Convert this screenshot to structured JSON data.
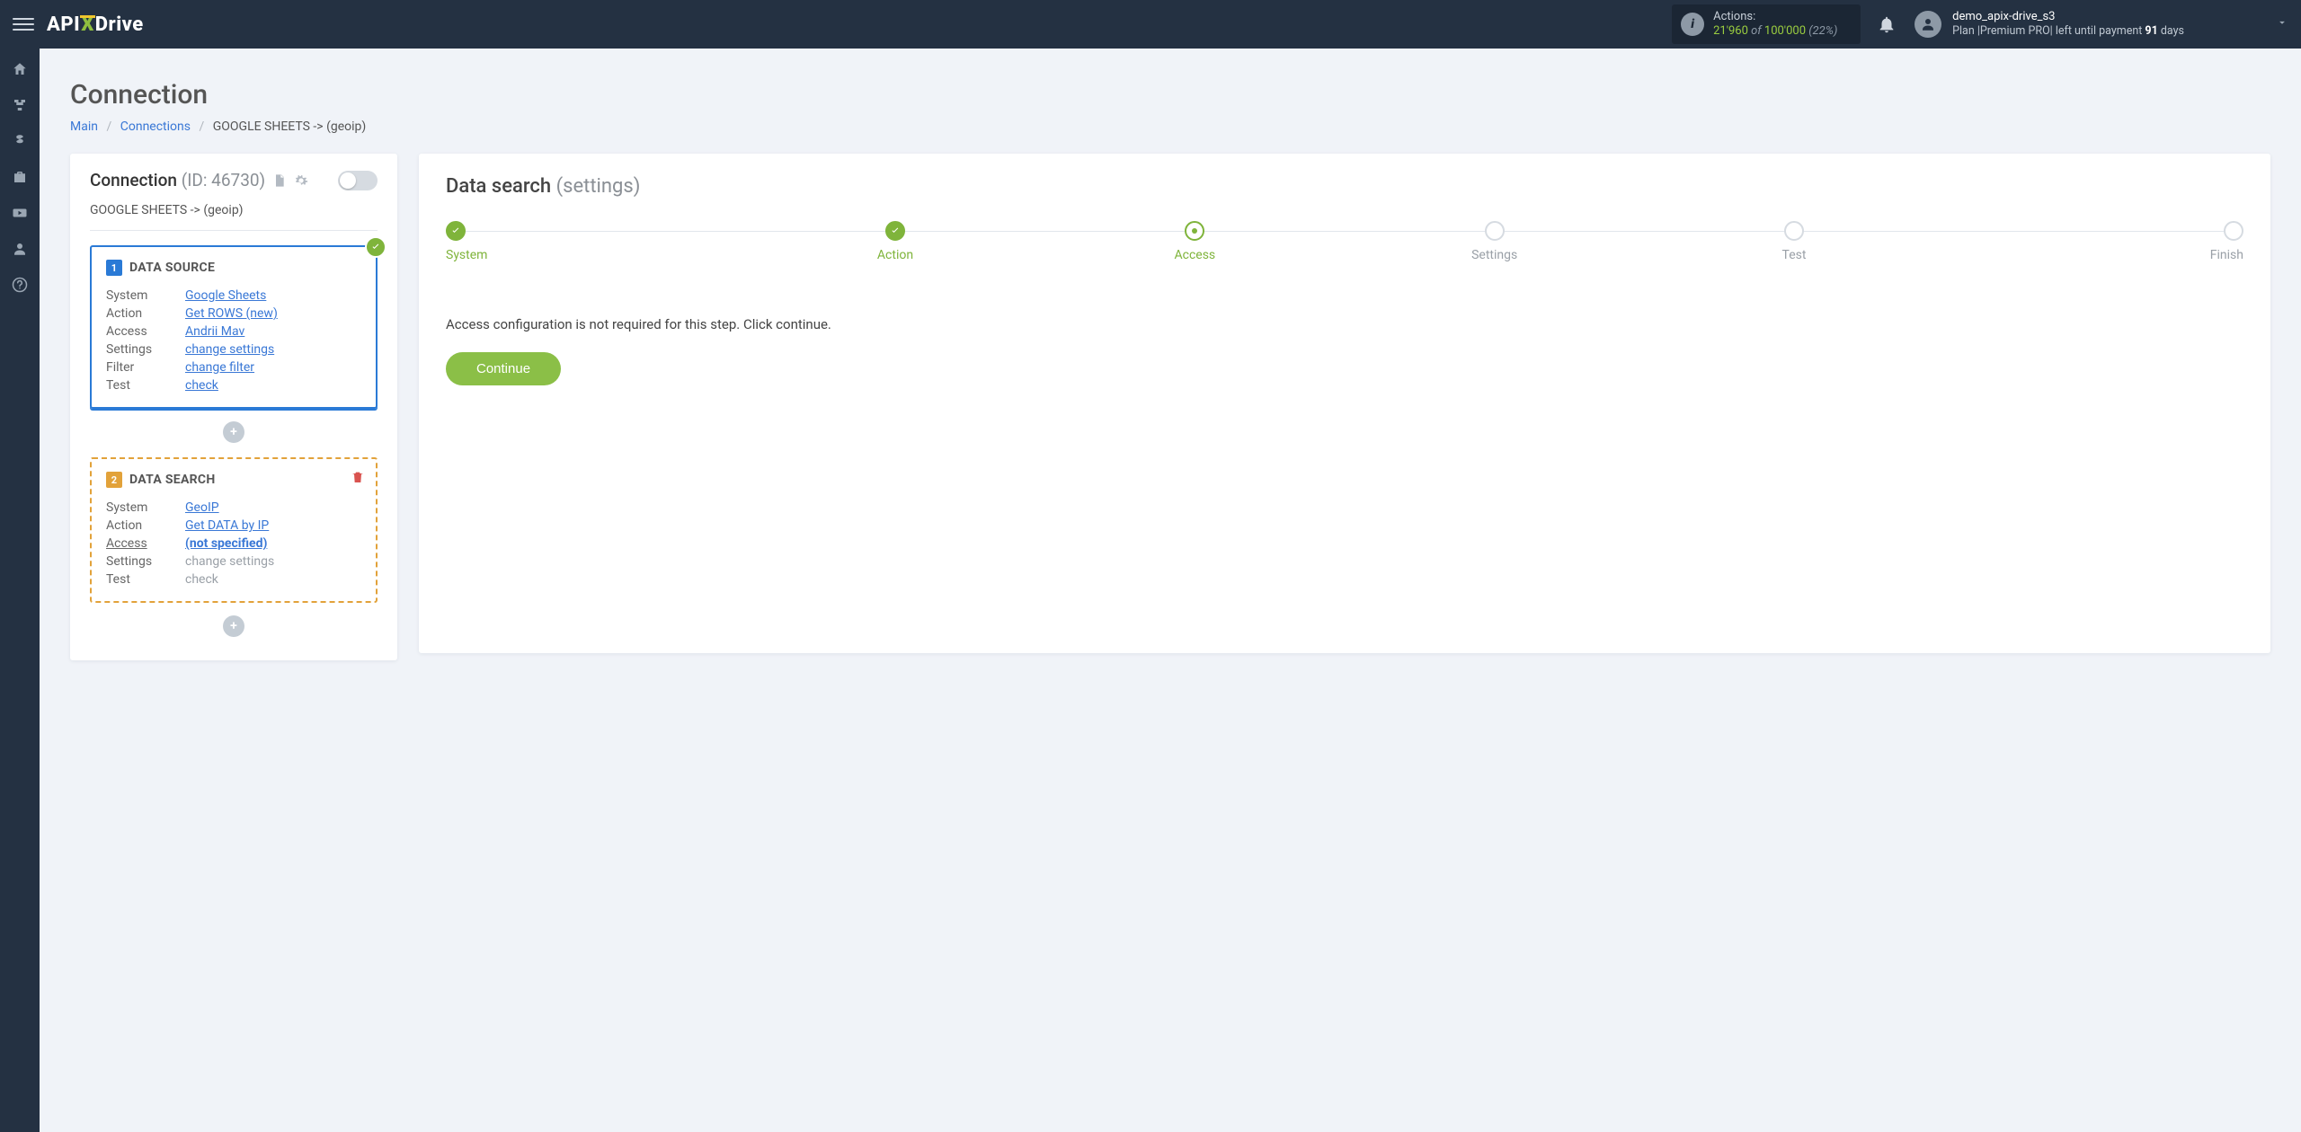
{
  "header": {
    "actions_label": "Actions:",
    "actions_used": "21'960",
    "actions_of": " of ",
    "actions_total": "100'000",
    "actions_pct": "(22%)",
    "user_name": "demo_apix-drive_s3",
    "plan_prefix": "Plan |",
    "plan_name": "Premium PRO",
    "plan_mid": "| left until payment ",
    "plan_days": "91",
    "plan_suffix": " days"
  },
  "page": {
    "title": "Connection",
    "bc_main": "Main",
    "bc_conn": "Connections",
    "bc_current": "GOOGLE SHEETS -> (geoip)"
  },
  "left": {
    "heading": "Connection",
    "id_text": "(ID: 46730)",
    "name": "GOOGLE SHEETS -> (geoip)",
    "block1": {
      "num": "1",
      "title": "DATA SOURCE",
      "rows": {
        "system_k": "System",
        "system_v": "Google Sheets",
        "action_k": "Action",
        "action_v": "Get ROWS (new)",
        "access_k": "Access",
        "access_v": "Andrii Mav",
        "settings_k": "Settings",
        "settings_v": "change settings",
        "filter_k": "Filter",
        "filter_v": "change filter",
        "test_k": "Test",
        "test_v": "check"
      }
    },
    "block2": {
      "num": "2",
      "title": "DATA SEARCH",
      "rows": {
        "system_k": "System",
        "system_v": "GeoIP",
        "action_k": "Action",
        "action_v": "Get DATA by IP",
        "access_k": "Access",
        "access_v": "(not specified)",
        "settings_k": "Settings",
        "settings_v": "change settings",
        "test_k": "Test",
        "test_v": "check"
      }
    }
  },
  "right": {
    "title": "Data search",
    "sub": "(settings)",
    "steps": {
      "system": "System",
      "action": "Action",
      "access": "Access",
      "settings": "Settings",
      "test": "Test",
      "finish": "Finish"
    },
    "msg": "Access configuration is not required for this step. Click continue.",
    "continue": "Continue"
  }
}
